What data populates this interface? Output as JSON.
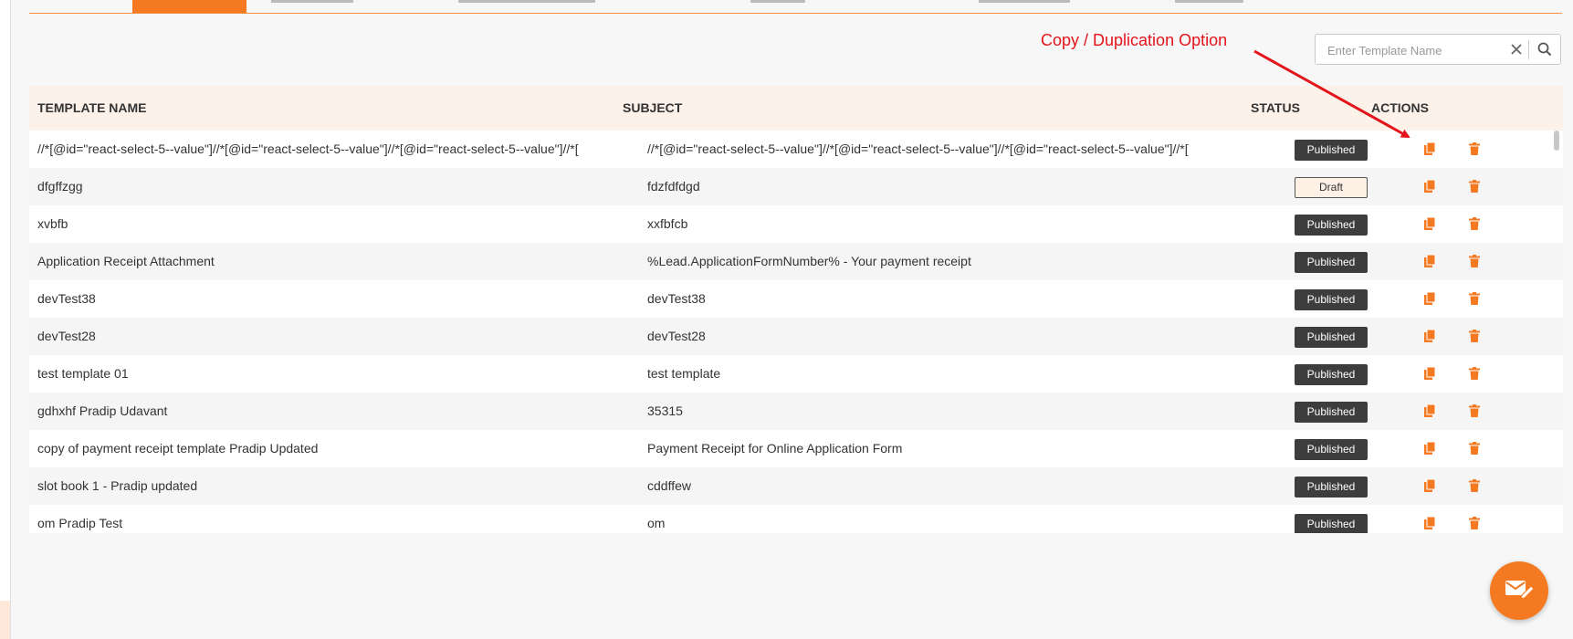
{
  "search": {
    "placeholder": "Enter Template Name",
    "value": ""
  },
  "annotation": {
    "text": "Copy / Duplication Option",
    "color": "#e3141b"
  },
  "table": {
    "headers": {
      "name": "TEMPLATE NAME",
      "subject": "SUBJECT",
      "status": "STATUS",
      "actions": "ACTIONS"
    },
    "rows": [
      {
        "name": "//*[@id=\"react-select-5--value\"]//*[@id=\"react-select-5--value\"]//*[@id=\"react-select-5--value\"]//*[",
        "subject": "//*[@id=\"react-select-5--value\"]//*[@id=\"react-select-5--value\"]//*[@id=\"react-select-5--value\"]//*[",
        "status": "Published"
      },
      {
        "name": "dfgffzgg",
        "subject": "fdzfdfdgd",
        "status": "Draft"
      },
      {
        "name": "xvbfb",
        "subject": "xxfbfcb",
        "status": "Published"
      },
      {
        "name": "Application Receipt Attachment",
        "subject": "%Lead.ApplicationFormNumber% - Your payment receipt",
        "status": "Published"
      },
      {
        "name": "devTest38",
        "subject": "devTest38",
        "status": "Published"
      },
      {
        "name": "devTest28",
        "subject": "devTest28",
        "status": "Published"
      },
      {
        "name": "test template 01",
        "subject": "test template",
        "status": "Published"
      },
      {
        "name": "gdhxhf Pradip Udavant",
        "subject": "35315",
        "status": "Published"
      },
      {
        "name": "copy of payment receipt template Pradip Updated",
        "subject": "Payment Receipt for Online Application Form",
        "status": "Published"
      },
      {
        "name": "slot book 1 - Pradip updated",
        "subject": "cddffew",
        "status": "Published"
      },
      {
        "name": "om Pradip Test",
        "subject": "om",
        "status": "Published"
      }
    ]
  },
  "icons": {
    "copy": "copy-icon",
    "delete": "trash-icon",
    "search": "search-icon",
    "clear": "close-icon",
    "compose": "mail-edit-icon"
  },
  "colors": {
    "accent": "#f47920",
    "header_bg": "#fdf2ea",
    "published_badge": "#3d3d3d",
    "draft_badge_bg": "#fdf0e5"
  }
}
